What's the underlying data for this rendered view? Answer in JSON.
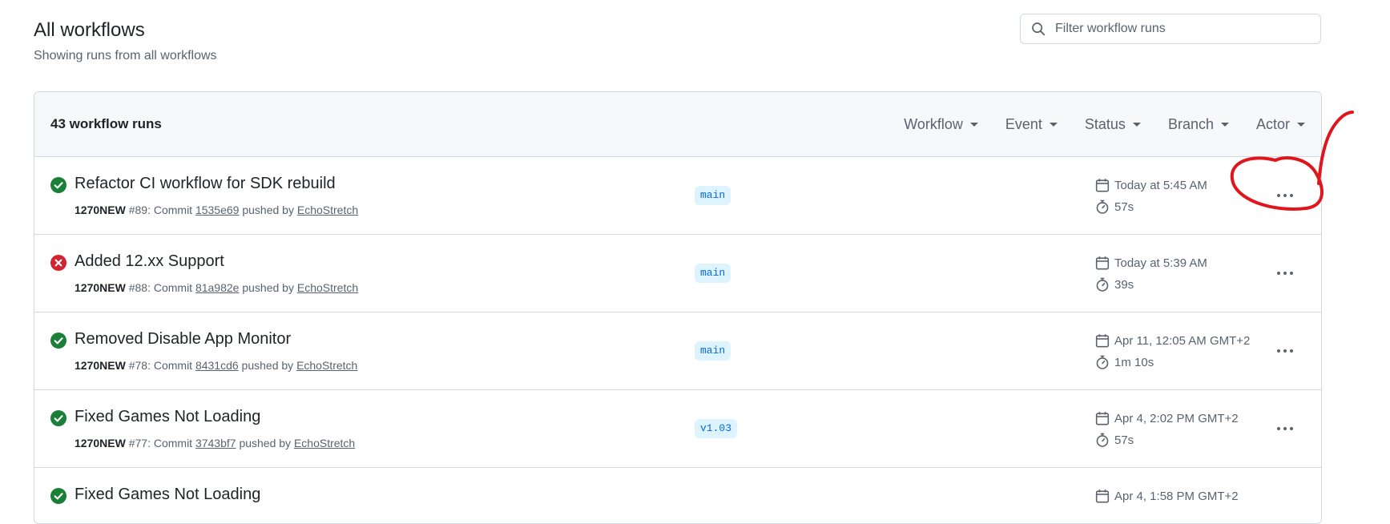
{
  "header": {
    "title": "All workflows",
    "subtitle": "Showing runs from all workflows"
  },
  "search": {
    "placeholder": "Filter workflow runs",
    "value": ""
  },
  "runs_header": {
    "count_label": "43 workflow runs",
    "filters": {
      "workflow": "Workflow",
      "event": "Event",
      "status": "Status",
      "branch": "Branch",
      "actor": "Actor"
    }
  },
  "runs": [
    {
      "status": "success",
      "title": "Refactor CI workflow for SDK rebuild",
      "workflow": "1270NEW",
      "run_number": "#89",
      "commit_label": ": Commit ",
      "commit": "1535e69",
      "pushed_by_label": " pushed by ",
      "actor": "EchoStretch",
      "branch": "main",
      "date": "Today at 5:45 AM",
      "duration": "57s"
    },
    {
      "status": "failure",
      "title": "Added 12.xx Support",
      "workflow": "1270NEW",
      "run_number": "#88",
      "commit_label": ": Commit ",
      "commit": "81a982e",
      "pushed_by_label": " pushed by ",
      "actor": "EchoStretch",
      "branch": "main",
      "date": "Today at 5:39 AM",
      "duration": "39s"
    },
    {
      "status": "success",
      "title": "Removed Disable App Monitor",
      "workflow": "1270NEW",
      "run_number": "#78",
      "commit_label": ": Commit ",
      "commit": "8431cd6",
      "pushed_by_label": " pushed by ",
      "actor": "EchoStretch",
      "branch": "main",
      "date": "Apr 11, 12:05 AM GMT+2",
      "duration": "1m 10s"
    },
    {
      "status": "success",
      "title": "Fixed Games Not Loading",
      "workflow": "1270NEW",
      "run_number": "#77",
      "commit_label": ": Commit ",
      "commit": "3743bf7",
      "pushed_by_label": " pushed by ",
      "actor": "EchoStretch",
      "branch": "v1.03",
      "date": "Apr 4, 2:02 PM GMT+2",
      "duration": "57s"
    },
    {
      "status": "success",
      "title": "Fixed Games Not Loading",
      "branch": "",
      "date": "Apr 4, 1:58 PM GMT+2",
      "duration": ""
    }
  ],
  "icons": {
    "search": "search-icon",
    "success": "check-circle-icon",
    "failure": "x-circle-icon",
    "calendar": "calendar-icon",
    "stopwatch": "stopwatch-icon",
    "menu": "kebab-horizontal-icon"
  },
  "colors": {
    "success": "#1a7f37",
    "failure": "#d1242f",
    "link": "#0969da",
    "branch_bg": "#ddf4ff",
    "annotation": "#e0161c"
  }
}
